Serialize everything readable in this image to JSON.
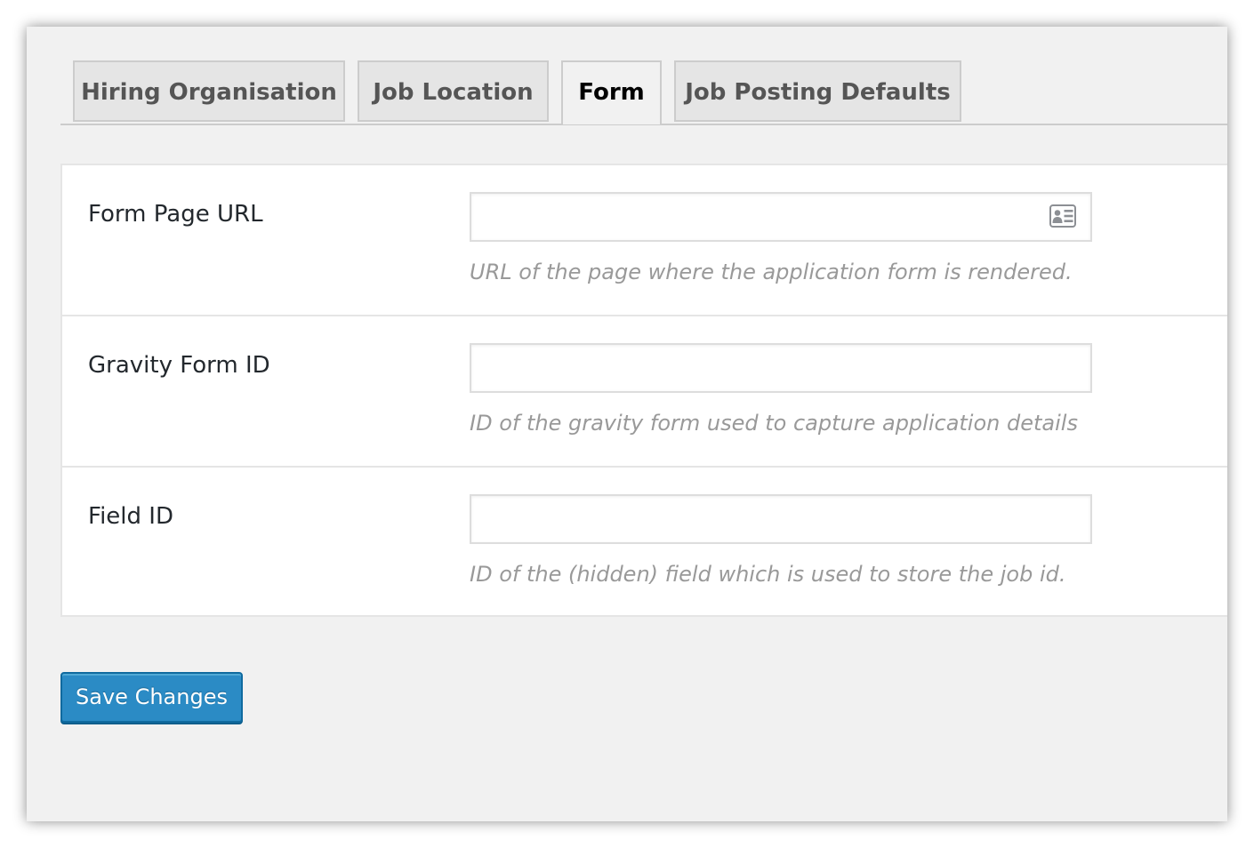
{
  "tabs": [
    {
      "label": "Hiring Organisation",
      "active": false
    },
    {
      "label": "Job Location",
      "active": false
    },
    {
      "label": "Form",
      "active": true
    },
    {
      "label": "Job Posting Defaults",
      "active": false
    }
  ],
  "fields": [
    {
      "label": "Form Page URL",
      "value": "",
      "description": "URL of the page where the application form is rendered.",
      "icon": "contact-card-icon"
    },
    {
      "label": "Gravity Form ID",
      "value": "",
      "description": "ID of the gravity form used to capture application details"
    },
    {
      "label": "Field ID",
      "value": "",
      "description": "ID of the (hidden) field which is used to store the job id."
    }
  ],
  "save_button": {
    "label": "Save Changes"
  },
  "colors": {
    "accent": "#2b8bc5",
    "background": "#f1f1f1",
    "description_text": "#999999"
  }
}
